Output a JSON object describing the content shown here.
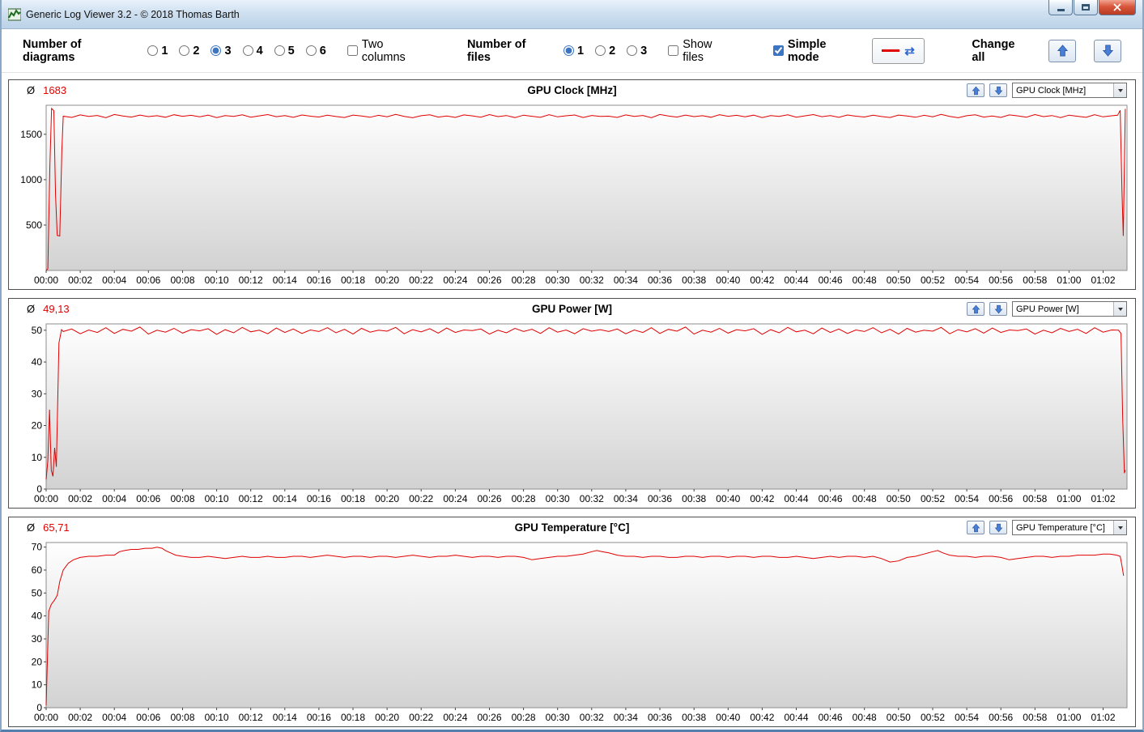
{
  "window": {
    "title": "Generic Log Viewer 3.2 - © 2018 Thomas Barth"
  },
  "toolbar": {
    "diagrams_label": "Number of diagrams",
    "diagram_options": [
      "1",
      "2",
      "3",
      "4",
      "5",
      "6"
    ],
    "diagrams_selected": "3",
    "two_columns_label": "Two columns",
    "two_columns_checked": false,
    "files_label": "Number of files",
    "file_options": [
      "1",
      "2",
      "3"
    ],
    "files_selected": "1",
    "show_files_label": "Show files",
    "show_files_checked": false,
    "simple_mode_label": "Simple mode",
    "simple_mode_checked": true,
    "change_all_label": "Change all",
    "line_sample_color": "#e10000",
    "swap_icon": "⇄"
  },
  "panels": [
    {
      "avg_symbol": "Ø",
      "avg_value": "1683",
      "title": "GPU Clock [MHz]",
      "dropdown_value": "GPU Clock [MHz]"
    },
    {
      "avg_symbol": "Ø",
      "avg_value": "49,13",
      "title": "GPU Power [W]",
      "dropdown_value": "GPU Power [W]"
    },
    {
      "avg_symbol": "Ø",
      "avg_value": "65,71",
      "title": "GPU Temperature [°C]",
      "dropdown_value": "GPU Temperature [°C]"
    }
  ],
  "chart_data": [
    {
      "type": "line",
      "title": "GPU Clock [MHz]",
      "series_color": "#e10000",
      "xlabel": "",
      "ylabel": "",
      "xlim": [
        0,
        63.4
      ],
      "ylim": [
        0,
        1820
      ],
      "yticks": [
        500,
        1000,
        1500
      ],
      "xtick_step_min": 2,
      "xtick_labels": [
        "00:00",
        "00:02",
        "00:04",
        "00:06",
        "00:08",
        "00:10",
        "00:12",
        "00:14",
        "00:16",
        "00:18",
        "00:20",
        "00:22",
        "00:24",
        "00:26",
        "00:28",
        "00:30",
        "00:32",
        "00:34",
        "00:36",
        "00:38",
        "00:40",
        "00:42",
        "00:44",
        "00:46",
        "00:48",
        "00:50",
        "00:52",
        "00:54",
        "00:56",
        "00:58",
        "01:00",
        "01:02"
      ],
      "head": [
        [
          0,
          0
        ],
        [
          0.1,
          20
        ],
        [
          0.22,
          1150
        ],
        [
          0.32,
          1785
        ],
        [
          0.45,
          1760
        ],
        [
          0.55,
          830
        ],
        [
          0.65,
          385
        ],
        [
          0.8,
          380
        ],
        [
          0.92,
          1320
        ]
      ],
      "uniform": {
        "t_start": 1.0,
        "dt": 0.5,
        "values": [
          1700,
          1686,
          1714,
          1697,
          1708,
          1683,
          1718,
          1701,
          1690,
          1712,
          1695,
          1705,
          1688,
          1716,
          1699,
          1709,
          1692,
          1711,
          1684,
          1706,
          1698,
          1715,
          1689,
          1703,
          1717,
          1694,
          1707,
          1687,
          1713,
          1700,
          1691,
          1710,
          1696,
          1685,
          1712,
          1702,
          1688,
          1709,
          1693,
          1719,
          1698,
          1683,
          1705,
          1715,
          1690,
          1701,
          1686,
          1714,
          1703,
          1689,
          1717,
          1695,
          1707,
          1684,
          1711,
          1699,
          1687,
          1716,
          1692,
          1704,
          1713,
          1685,
          1708,
          1697,
          1700,
          1686,
          1714,
          1697,
          1708,
          1683,
          1718,
          1701,
          1690,
          1712,
          1695,
          1705,
          1688,
          1716,
          1699,
          1709,
          1692,
          1711,
          1684,
          1706,
          1698,
          1715,
          1689,
          1703,
          1717,
          1694,
          1707,
          1687,
          1713,
          1700,
          1691,
          1710,
          1696,
          1685,
          1712,
          1702,
          1688,
          1709,
          1693,
          1719,
          1698,
          1683,
          1705,
          1715,
          1690,
          1701,
          1686,
          1714,
          1703,
          1689,
          1717,
          1695,
          1707,
          1684,
          1711,
          1699,
          1687,
          1716,
          1692,
          1704
        ]
      },
      "tail": [
        [
          62.85,
          1710
        ],
        [
          63.0,
          1765
        ],
        [
          63.1,
          900
        ],
        [
          63.18,
          380
        ],
        [
          63.3,
          1780
        ]
      ]
    },
    {
      "type": "line",
      "title": "GPU Power [W]",
      "series_color": "#e10000",
      "xlabel": "",
      "ylabel": "",
      "xlim": [
        0,
        63.4
      ],
      "ylim": [
        0,
        52
      ],
      "yticks": [
        0,
        10,
        20,
        30,
        40,
        50
      ],
      "xtick_step_min": 2,
      "xtick_labels": [
        "00:00",
        "00:02",
        "00:04",
        "00:06",
        "00:08",
        "00:10",
        "00:12",
        "00:14",
        "00:16",
        "00:18",
        "00:20",
        "00:22",
        "00:24",
        "00:26",
        "00:28",
        "00:30",
        "00:32",
        "00:34",
        "00:36",
        "00:38",
        "00:40",
        "00:42",
        "00:44",
        "00:46",
        "00:48",
        "00:50",
        "00:52",
        "00:54",
        "00:56",
        "00:58",
        "01:00",
        "01:02"
      ],
      "head": [
        [
          0,
          3
        ],
        [
          0.1,
          9
        ],
        [
          0.2,
          25
        ],
        [
          0.3,
          6
        ],
        [
          0.4,
          4
        ],
        [
          0.5,
          13
        ],
        [
          0.6,
          7
        ],
        [
          0.75,
          46
        ],
        [
          0.9,
          50.2
        ]
      ],
      "uniform": {
        "t_start": 1.0,
        "dt": 0.5,
        "values": [
          49.6,
          50.4,
          48.9,
          50.1,
          49.3,
          50.8,
          49.0,
          50.3,
          49.7,
          51.0,
          48.8,
          50.0,
          49.4,
          50.6,
          49.1,
          50.2,
          49.8,
          50.5,
          48.7,
          50.2,
          49.2,
          50.9,
          49.5,
          50.0,
          48.9,
          50.7,
          49.3,
          50.4,
          49.0,
          50.1,
          49.6,
          50.8,
          49.2,
          50.3,
          48.8,
          50.6,
          49.4,
          50.0,
          49.7,
          50.9,
          48.9,
          50.2,
          49.5,
          50.5,
          49.1,
          50.7,
          49.3,
          50.1,
          49.9,
          50.4,
          48.8,
          50.0,
          49.2,
          50.6,
          49.6,
          50.3,
          49.0,
          50.8,
          49.4,
          50.1,
          48.9,
          50.5,
          49.7,
          50.2,
          49.6,
          50.4,
          48.9,
          50.1,
          49.3,
          50.8,
          49.0,
          50.3,
          49.7,
          51.0,
          48.8,
          50.0,
          49.4,
          50.6,
          49.1,
          50.2,
          49.8,
          50.5,
          48.7,
          50.2,
          49.2,
          50.9,
          49.5,
          50.0,
          48.9,
          50.7,
          49.3,
          50.4,
          49.0,
          50.1,
          49.6,
          50.8,
          49.2,
          50.3,
          48.8,
          50.6,
          49.4,
          50.0,
          49.7,
          50.9,
          48.9,
          50.2,
          49.5,
          50.5,
          49.1,
          50.7,
          49.3,
          50.1,
          49.9,
          50.4,
          48.8,
          50.0,
          49.2,
          50.6,
          49.6,
          50.3,
          49.0,
          50.8,
          49.4,
          50.1
        ]
      },
      "tail": [
        [
          62.9,
          50.0
        ],
        [
          63.05,
          49.0
        ],
        [
          63.15,
          22
        ],
        [
          63.25,
          5
        ],
        [
          63.3,
          6
        ]
      ]
    },
    {
      "type": "line",
      "title": "GPU Temperature [°C]",
      "series_color": "#e10000",
      "xlabel": "",
      "ylabel": "",
      "xlim": [
        0,
        63.4
      ],
      "ylim": [
        0,
        72
      ],
      "yticks": [
        0,
        10,
        20,
        30,
        40,
        50,
        60,
        70
      ],
      "xtick_step_min": 2,
      "xtick_labels": [
        "00:00",
        "00:02",
        "00:04",
        "00:06",
        "00:08",
        "00:10",
        "00:12",
        "00:14",
        "00:16",
        "00:18",
        "00:20",
        "00:22",
        "00:24",
        "00:26",
        "00:28",
        "00:30",
        "00:32",
        "00:34",
        "00:36",
        "00:38",
        "00:40",
        "00:42",
        "00:44",
        "00:46",
        "00:48",
        "00:50",
        "00:52",
        "00:54",
        "00:56",
        "00:58",
        "01:00",
        "01:02"
      ],
      "points": [
        [
          0,
          1
        ],
        [
          0.15,
          42
        ],
        [
          0.3,
          45
        ],
        [
          0.5,
          47
        ],
        [
          0.65,
          49
        ],
        [
          0.8,
          55
        ],
        [
          1,
          60
        ],
        [
          1.3,
          63
        ],
        [
          1.6,
          64.5
        ],
        [
          2,
          65.5
        ],
        [
          2.5,
          66
        ],
        [
          3,
          66
        ],
        [
          3.5,
          66.5
        ],
        [
          4,
          66.5
        ],
        [
          4.3,
          68
        ],
        [
          4.6,
          68.5
        ],
        [
          5,
          69
        ],
        [
          5.4,
          69
        ],
        [
          5.8,
          69.5
        ],
        [
          6.2,
          69.5
        ],
        [
          6.5,
          70
        ],
        [
          6.8,
          69.5
        ],
        [
          7,
          68.5
        ],
        [
          7.3,
          67.5
        ],
        [
          7.6,
          66.5
        ],
        [
          8,
          66
        ],
        [
          8.5,
          65.5
        ],
        [
          9,
          65.5
        ],
        [
          9.5,
          66
        ],
        [
          10,
          65.5
        ],
        [
          10.5,
          65
        ],
        [
          11,
          65.5
        ],
        [
          11.5,
          66
        ],
        [
          12,
          65.5
        ],
        [
          12.5,
          65.5
        ],
        [
          13,
          66
        ],
        [
          13.5,
          65.5
        ],
        [
          14,
          65.5
        ],
        [
          14.5,
          66
        ],
        [
          15,
          66
        ],
        [
          15.5,
          65.5
        ],
        [
          16,
          66
        ],
        [
          16.5,
          66.5
        ],
        [
          17,
          66
        ],
        [
          17.5,
          65.5
        ],
        [
          18,
          66
        ],
        [
          18.5,
          66
        ],
        [
          19,
          65.5
        ],
        [
          19.5,
          66
        ],
        [
          20,
          66
        ],
        [
          20.5,
          65.5
        ],
        [
          21,
          66
        ],
        [
          21.5,
          66.5
        ],
        [
          22,
          66
        ],
        [
          22.5,
          65.5
        ],
        [
          23,
          66
        ],
        [
          23.5,
          66
        ],
        [
          24,
          66.5
        ],
        [
          24.5,
          66
        ],
        [
          25,
          65.5
        ],
        [
          25.5,
          66
        ],
        [
          26,
          66
        ],
        [
          26.5,
          65.5
        ],
        [
          27,
          66
        ],
        [
          27.5,
          66
        ],
        [
          28,
          65.5
        ],
        [
          28.5,
          64.5
        ],
        [
          29,
          65
        ],
        [
          29.5,
          65.5
        ],
        [
          30,
          66
        ],
        [
          30.5,
          66
        ],
        [
          31,
          66.5
        ],
        [
          31.5,
          67
        ],
        [
          32,
          68
        ],
        [
          32.3,
          68.5
        ],
        [
          32.6,
          68
        ],
        [
          33,
          67.5
        ],
        [
          33.5,
          66.5
        ],
        [
          34,
          66
        ],
        [
          34.5,
          66
        ],
        [
          35,
          65.5
        ],
        [
          35.5,
          66
        ],
        [
          36,
          66
        ],
        [
          36.5,
          65.5
        ],
        [
          37,
          65.5
        ],
        [
          37.5,
          66
        ],
        [
          38,
          66
        ],
        [
          38.5,
          65.5
        ],
        [
          39,
          66
        ],
        [
          39.5,
          66
        ],
        [
          40,
          65.5
        ],
        [
          40.5,
          66
        ],
        [
          41,
          66
        ],
        [
          41.5,
          65.5
        ],
        [
          42,
          66
        ],
        [
          42.5,
          66
        ],
        [
          43,
          65.5
        ],
        [
          43.5,
          65.5
        ],
        [
          44,
          66
        ],
        [
          44.5,
          65.5
        ],
        [
          45,
          65
        ],
        [
          45.5,
          65.5
        ],
        [
          46,
          66
        ],
        [
          46.5,
          65.5
        ],
        [
          47,
          66
        ],
        [
          47.5,
          66
        ],
        [
          48,
          65.5
        ],
        [
          48.5,
          66
        ],
        [
          49,
          65
        ],
        [
          49.5,
          63.5
        ],
        [
          50,
          64
        ],
        [
          50.5,
          65.5
        ],
        [
          51,
          66
        ],
        [
          51.5,
          67
        ],
        [
          52,
          68
        ],
        [
          52.3,
          68.5
        ],
        [
          52.6,
          67.5
        ],
        [
          53,
          66.5
        ],
        [
          53.5,
          66
        ],
        [
          54,
          66
        ],
        [
          54.5,
          65.5
        ],
        [
          55,
          66
        ],
        [
          55.5,
          66
        ],
        [
          56,
          65.5
        ],
        [
          56.5,
          64.5
        ],
        [
          57,
          65
        ],
        [
          57.5,
          65.5
        ],
        [
          58,
          66
        ],
        [
          58.5,
          66
        ],
        [
          59,
          65.5
        ],
        [
          59.5,
          66
        ],
        [
          60,
          66
        ],
        [
          60.5,
          66.5
        ],
        [
          61,
          66.5
        ],
        [
          61.5,
          66.5
        ],
        [
          62,
          67
        ],
        [
          62.4,
          67
        ],
        [
          62.8,
          66.5
        ],
        [
          63,
          66
        ],
        [
          63.1,
          62
        ],
        [
          63.2,
          57.5
        ]
      ]
    }
  ]
}
